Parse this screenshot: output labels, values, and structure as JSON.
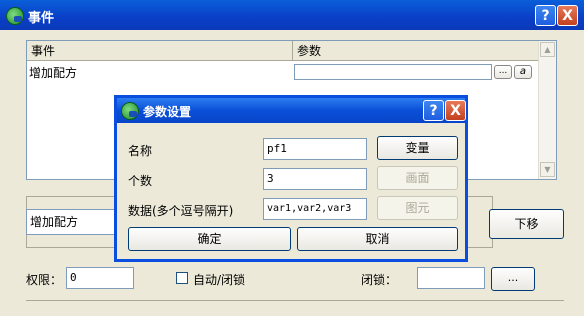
{
  "window": {
    "title": "事件",
    "help_glyph": "?",
    "close_glyph": "X"
  },
  "grid": {
    "columns": [
      "事件",
      "参数"
    ],
    "rows": [
      {
        "event": "增加配方",
        "param": ""
      }
    ],
    "row_button_1": "...",
    "row_button_2": "a"
  },
  "event_select": {
    "value": "增加配方"
  },
  "move_down_label": "下移",
  "permission": {
    "label": "权限：",
    "value": "0"
  },
  "auto_lock": {
    "label": "自动/闭锁",
    "checked": false
  },
  "lock": {
    "label": "闭锁：",
    "value": "",
    "button_label": "..."
  },
  "dialog": {
    "title": "参数设置",
    "help_glyph": "?",
    "close_glyph": "X",
    "fields": [
      {
        "label": "名称",
        "value": "pf1",
        "button": "变量",
        "button_enabled": true
      },
      {
        "label": "个数",
        "value": "3",
        "button": "画面",
        "button_enabled": false
      },
      {
        "label": "数据(多个逗号隔开)",
        "value": "var1,var2,var3",
        "button": "图元",
        "button_enabled": false
      }
    ],
    "ok_label": "确定",
    "cancel_label": "取消"
  }
}
